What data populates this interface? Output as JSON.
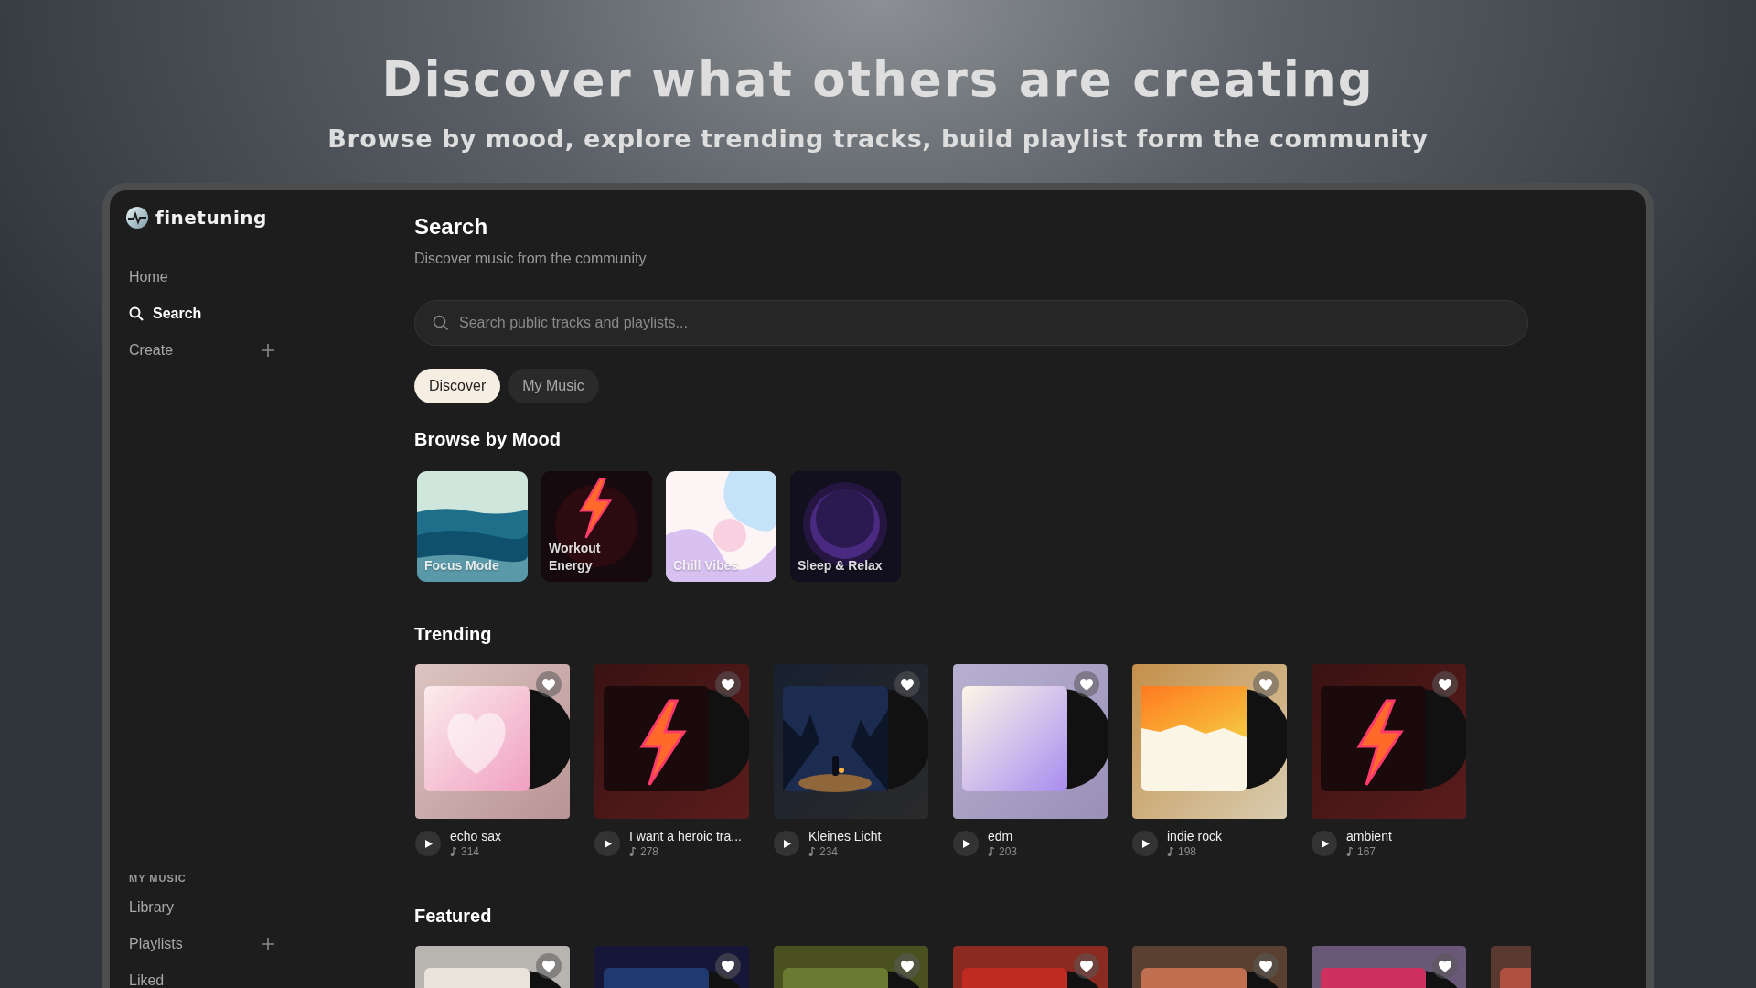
{
  "hero": {
    "title": "Discover what others are creating",
    "subtitle": "Browse by mood, explore trending tracks, build playlist form the community"
  },
  "sidebar": {
    "brand": "finetuning",
    "nav": [
      {
        "label": "Home",
        "kind": "plain",
        "selected": false
      },
      {
        "label": "Search",
        "kind": "search",
        "selected": true
      },
      {
        "label": "Create",
        "kind": "add",
        "selected": false
      }
    ],
    "section_label": "MY MUSIC",
    "library": [
      {
        "label": "Library",
        "kind": "plain",
        "selected": false
      },
      {
        "label": "Playlists",
        "kind": "add",
        "selected": false
      },
      {
        "label": "Liked",
        "kind": "plain",
        "selected": false
      }
    ]
  },
  "main": {
    "title": "Search",
    "subtitle": "Discover music from the community",
    "search": {
      "placeholder": "Search public tracks and playlists..."
    },
    "tabs": [
      {
        "label": "Discover",
        "selected": true
      },
      {
        "label": "My Music",
        "selected": false
      }
    ],
    "mood": {
      "title": "Browse by Mood",
      "items": [
        {
          "label": "Focus Mode"
        },
        {
          "label": "Workout Energy"
        },
        {
          "label": "Chill Vibes"
        },
        {
          "label": "Sleep & Relax"
        }
      ]
    },
    "trending": {
      "title": "Trending",
      "items": [
        {
          "title": "echo sax",
          "plays": "314"
        },
        {
          "title": "I want a heroic tra...",
          "plays": "278"
        },
        {
          "title": "Kleines Licht",
          "plays": "234"
        },
        {
          "title": "edm",
          "plays": "203"
        },
        {
          "title": "indie rock",
          "plays": "198"
        },
        {
          "title": "ambient",
          "plays": "167"
        }
      ]
    },
    "featured": {
      "title": "Featured",
      "items": [
        {
          "kind": "picture"
        },
        {
          "kind": "picture"
        },
        {
          "kind": "picture"
        },
        {
          "kind": "picture"
        },
        {
          "kind": "picture"
        },
        {
          "kind": "picture"
        },
        {
          "kind": "partial"
        }
      ]
    }
  }
}
